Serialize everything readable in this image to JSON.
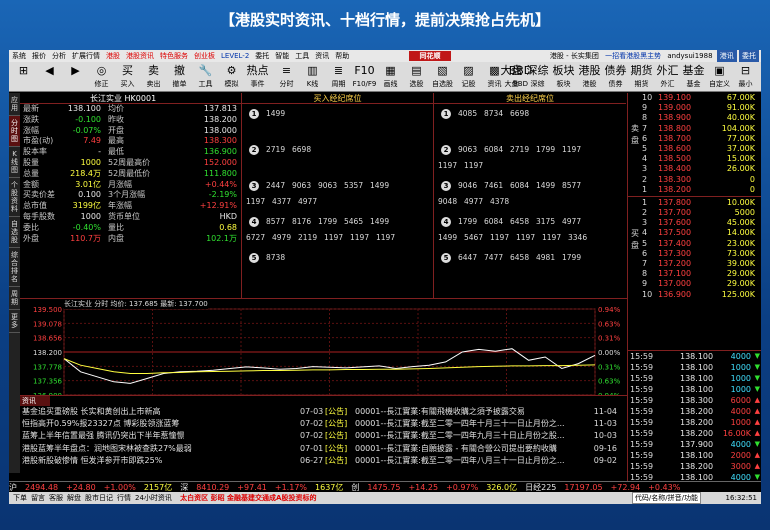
{
  "banner": "【港股实时资讯、十档行情，提前决策抢占先机】",
  "menu": {
    "items": [
      "系统",
      "报价",
      "分析",
      "扩展行情",
      "港股",
      "港股资讯",
      "特色服务",
      "创业板",
      "LEVEL-2",
      "委托",
      "智能",
      "工具",
      "资讯",
      "帮助"
    ],
    "brand": "同花顺",
    "crumb": "港股 - 长实集团",
    "promo": "一招看港股黑主势",
    "user": "andysui1988",
    "right_box1": "港讯",
    "right_box2": "委托"
  },
  "toolbar": {
    "left": [
      {
        "icon": "⊞",
        "label": ""
      },
      {
        "icon": "◀",
        "label": ""
      },
      {
        "icon": "▶",
        "label": ""
      },
      {
        "icon": "◎",
        "label": "修正"
      },
      {
        "icon": "买",
        "label": "买入"
      },
      {
        "icon": "卖",
        "label": "卖出"
      },
      {
        "icon": "撤",
        "label": "撤单"
      },
      {
        "icon": "🔧",
        "label": "工具"
      },
      {
        "icon": "⚙",
        "label": "模拟"
      },
      {
        "icon": "热点",
        "label": "事件"
      }
    ],
    "mid": [
      {
        "icon": "≡",
        "label": "分时"
      },
      {
        "icon": "▥",
        "label": "K线"
      },
      {
        "icon": "≣",
        "label": "周期"
      },
      {
        "icon": "F10",
        "label": "F10/F9"
      },
      {
        "icon": "▦",
        "label": "画线"
      },
      {
        "icon": "▤",
        "label": "选股"
      },
      {
        "icon": "▧",
        "label": "自选股"
      },
      {
        "icon": "▨",
        "label": "记股"
      },
      {
        "icon": "▩",
        "label": "资讯"
      },
      {
        "icon": "BBD",
        "label": "BBD"
      }
    ],
    "right": [
      {
        "icon": "大盘",
        "label": "大盘"
      },
      {
        "icon": "深综",
        "label": "深综"
      },
      {
        "icon": "板块",
        "label": "板块"
      },
      {
        "icon": "港股",
        "label": "港股"
      },
      {
        "icon": "债券",
        "label": "债券"
      },
      {
        "icon": "期货",
        "label": "期货"
      },
      {
        "icon": "外汇",
        "label": "外汇"
      },
      {
        "icon": "基金",
        "label": "基金"
      },
      {
        "icon": "▣",
        "label": "自定义"
      },
      {
        "icon": "⊟",
        "label": "最小"
      }
    ]
  },
  "left_tabs": [
    {
      "label": "应用",
      "active": false
    },
    {
      "label": "分时图",
      "active": true
    },
    {
      "label": "K线图",
      "active": false
    },
    {
      "label": "个股资料",
      "active": false
    },
    {
      "label": "自选股",
      "active": false
    },
    {
      "label": "综合排名",
      "active": false
    },
    {
      "label": "周期",
      "active": false
    },
    {
      "label": "更多",
      "active": false
    }
  ],
  "quote": {
    "title": "长江实业 HK0001",
    "rows": [
      {
        "l1": "最新",
        "v1": "138.100",
        "c1": "white",
        "l2": "均价",
        "v2": "137.813",
        "c2": "white"
      },
      {
        "l1": "涨跌",
        "v1": "-0.100",
        "c1": "green",
        "l2": "昨收",
        "v2": "138.200",
        "c2": "white"
      },
      {
        "l1": "涨幅",
        "v1": "-0.07%",
        "c1": "green",
        "l2": "开盘",
        "v2": "138.000",
        "c2": "white"
      },
      {
        "l1": "市盈(动)",
        "v1": "7.49",
        "c1": "red",
        "l2": "最高",
        "v2": "138.300",
        "c2": "red"
      },
      {
        "l1": "股本率",
        "v1": "-",
        "c1": "white",
        "l2": "最低",
        "v2": "136.900",
        "c2": "green"
      },
      {
        "l1": "股量",
        "v1": "1000",
        "c1": "yellow",
        "l2": "52周最高价",
        "v2": "152.000",
        "c2": "red"
      },
      {
        "l1": "总量",
        "v1": "218.4万",
        "c1": "yellow",
        "l2": "52周最低价",
        "v2": "111.800",
        "c2": "green"
      },
      {
        "l1": "金额",
        "v1": "3.01亿",
        "c1": "yellow",
        "l2": "月涨幅",
        "v2": "+0.44%",
        "c2": "red"
      },
      {
        "l1": "买卖价差",
        "v1": "0.100",
        "c1": "white",
        "l2": "3个月涨幅",
        "v2": "-2.19%",
        "c2": "green"
      },
      {
        "l1": "总市值",
        "v1": "3199亿",
        "c1": "yellow",
        "l2": "年涨幅",
        "v2": "+12.91%",
        "c2": "red"
      },
      {
        "l1": "每手股数",
        "v1": "1000",
        "c1": "white",
        "l2": "货币单位",
        "v2": "HKD",
        "c2": "white"
      },
      {
        "l1": "委比",
        "v1": "-0.40%",
        "c1": "green",
        "l2": "量比",
        "v2": "0.68",
        "c2": "yellow"
      },
      {
        "l1": "外盘",
        "v1": "110.7万",
        "c1": "red",
        "l2": "内盘",
        "v2": "102.1万",
        "c2": "green"
      }
    ]
  },
  "brokers": {
    "buy_title": "买入经纪席位",
    "sell_title": "卖出经纪席位",
    "buy": [
      {
        "n": "1",
        "lines": [
          [
            "1499"
          ]
        ]
      },
      {
        "n": "2",
        "lines": [
          [
            "2719",
            "6698"
          ]
        ]
      },
      {
        "n": "3",
        "lines": [
          [
            "2447",
            "9063",
            "9063",
            "5357",
            "1499"
          ],
          [
            "1197",
            "4377",
            "4977"
          ]
        ]
      },
      {
        "n": "4",
        "lines": [
          [
            "8577",
            "8176",
            "1799",
            "5465",
            "1499"
          ],
          [
            "6727",
            "4979",
            "2119",
            "1197",
            "1197",
            "1197"
          ]
        ]
      },
      {
        "n": "5",
        "lines": [
          [
            "8738"
          ]
        ]
      }
    ],
    "sell": [
      {
        "n": "1",
        "lines": [
          [
            "4085",
            "8734",
            "6698"
          ]
        ]
      },
      {
        "n": "2",
        "lines": [
          [
            "9063",
            "6084",
            "2719",
            "1799",
            "1197"
          ],
          [
            "1197",
            "1197"
          ]
        ]
      },
      {
        "n": "3",
        "lines": [
          [
            "9046",
            "7461",
            "6084",
            "1499",
            "8577"
          ],
          [
            "9048",
            "4977",
            "4378"
          ]
        ]
      },
      {
        "n": "4",
        "lines": [
          [
            "1799",
            "6084",
            "6458",
            "3175",
            "4977"
          ],
          [
            "1499",
            "5467",
            "1197",
            "1197",
            "1197",
            "3346"
          ]
        ]
      },
      {
        "n": "5",
        "lines": [
          [
            "6447",
            "7477",
            "6458",
            "4981",
            "1799"
          ]
        ]
      }
    ]
  },
  "orderbook": {
    "sell_label": "卖盘",
    "buy_label": "买盘",
    "sell": [
      {
        "n": "10",
        "p": "139.100",
        "q": "67.00K"
      },
      {
        "n": "9",
        "p": "139.000",
        "q": "91.00K"
      },
      {
        "n": "8",
        "p": "138.900",
        "q": "40.00K"
      },
      {
        "n": "7",
        "p": "138.800",
        "q": "104.00K"
      },
      {
        "n": "6",
        "p": "138.700",
        "q": "77.00K"
      },
      {
        "n": "5",
        "p": "138.600",
        "q": "37.00K"
      },
      {
        "n": "4",
        "p": "138.500",
        "q": "15.00K"
      },
      {
        "n": "3",
        "p": "138.400",
        "q": "26.00K"
      },
      {
        "n": "2",
        "p": "138.300",
        "q": "0"
      },
      {
        "n": "1",
        "p": "138.200",
        "q": "0"
      }
    ],
    "buy": [
      {
        "n": "1",
        "p": "137.800",
        "q": "10.00K"
      },
      {
        "n": "2",
        "p": "137.700",
        "q": "5000"
      },
      {
        "n": "3",
        "p": "137.600",
        "q": "45.00K"
      },
      {
        "n": "4",
        "p": "137.500",
        "q": "14.00K"
      },
      {
        "n": "5",
        "p": "137.400",
        "q": "23.00K"
      },
      {
        "n": "6",
        "p": "137.300",
        "q": "73.00K"
      },
      {
        "n": "7",
        "p": "137.200",
        "q": "39.00K"
      },
      {
        "n": "8",
        "p": "137.100",
        "q": "29.00K"
      },
      {
        "n": "9",
        "p": "137.000",
        "q": "29.00K"
      },
      {
        "n": "10",
        "p": "136.900",
        "q": "125.00K"
      }
    ]
  },
  "ticks": [
    {
      "t": "15:59",
      "p": "138.100",
      "q": "4000",
      "a": "▼",
      "c": "green"
    },
    {
      "t": "15:59",
      "p": "138.100",
      "q": "1000",
      "a": "▼",
      "c": "green"
    },
    {
      "t": "15:59",
      "p": "138.100",
      "q": "1000",
      "a": "▼",
      "c": "green"
    },
    {
      "t": "15:59",
      "p": "138.100",
      "q": "1000",
      "a": "▼",
      "c": "green"
    },
    {
      "t": "15:59",
      "p": "138.300",
      "q": "6000",
      "a": "▲",
      "c": "red"
    },
    {
      "t": "15:59",
      "p": "138.200",
      "q": "4000",
      "a": "▲",
      "c": "red"
    },
    {
      "t": "15:59",
      "p": "138.200",
      "q": "1000",
      "a": "▲",
      "c": "red"
    },
    {
      "t": "15:59",
      "p": "138.200",
      "q": "16.00K",
      "a": "▲",
      "c": "red"
    },
    {
      "t": "15:59",
      "p": "137.900",
      "q": "4000",
      "a": "▼",
      "c": "green"
    },
    {
      "t": "15:59",
      "p": "138.100",
      "q": "2000",
      "a": "▲",
      "c": "red"
    },
    {
      "t": "15:59",
      "p": "138.200",
      "q": "3000",
      "a": "▲",
      "c": "red"
    },
    {
      "t": "15:59",
      "p": "138.100",
      "q": "4000",
      "a": "▼",
      "c": "green"
    },
    {
      "t": "15:59",
      "p": "138.100",
      "q": "1000",
      "a": "▼",
      "c": "green"
    }
  ],
  "chart_title": "长江实业 分时 均价: 137.685 最新: 137.700",
  "chart_data": {
    "type": "line",
    "x_ticks": [
      "09:30",
      "10:30",
      "11:30",
      "13:00",
      "14:00",
      "15:00",
      "16:00"
    ],
    "y_left_ticks": [
      "139.500",
      "139.078",
      "138.656",
      "138.200",
      "137.778",
      "137.356",
      "136.900"
    ],
    "y_right_ticks": [
      "0.94%",
      "0.63%",
      "0.31%",
      "0.00%",
      "0.31%",
      "0.63%",
      "0.94%"
    ],
    "volume_ticks": [
      "7900",
      "3950"
    ],
    "prev_close": 138.2,
    "ylim": [
      136.9,
      139.5
    ],
    "series": [
      {
        "name": "价格",
        "color": "#ffffff",
        "values": [
          138.0,
          137.6,
          137.45,
          137.3,
          137.25,
          137.4,
          137.55,
          137.6,
          137.62,
          137.65,
          137.7,
          137.75,
          137.72,
          137.68,
          137.7,
          137.76,
          137.74,
          137.72,
          137.75,
          137.78,
          137.7,
          137.76,
          137.8,
          137.9,
          138.2,
          138.28,
          138.22,
          138.3,
          137.95,
          138.05,
          137.7,
          137.85,
          138.1
        ]
      },
      {
        "name": "均价",
        "color": "#ffff40",
        "values": [
          138.0,
          137.8,
          137.7,
          137.6,
          137.55,
          137.55,
          137.57,
          137.58,
          137.6,
          137.61,
          137.62,
          137.63,
          137.64,
          137.64,
          137.65,
          137.66,
          137.66,
          137.67,
          137.67,
          137.68,
          137.68,
          137.69,
          137.7,
          137.72,
          137.74,
          137.76,
          137.77,
          137.78,
          137.78,
          137.79,
          137.79,
          137.8,
          137.81
        ]
      }
    ],
    "volume": [
      0.9,
      0.5,
      0.3,
      0.35,
      0.25,
      0.3,
      0.2,
      0.25,
      0.2,
      0.22,
      0.18,
      0.2,
      0.15,
      0.18,
      0.2,
      0.15,
      0.2,
      0.18,
      0.22,
      0.2,
      0.25,
      0.3,
      0.28,
      0.35,
      0.4,
      0.45,
      0.5,
      0.4,
      0.55,
      0.45,
      0.5,
      0.6,
      0.95
    ]
  },
  "news": {
    "tag": "资讯",
    "rows": [
      {
        "lt": "基金追买重磅股 长实和黄创出上市新高",
        "d": "07-03",
        "tag": "[公告]",
        "rt": "00001--長江實業:有關飛機收購之須予披露交易",
        "d2": "11-04"
      },
      {
        "lt": "恒指高开0.59%报23327点 博彩股领涨蓝筹",
        "d": "07-02",
        "tag": "[公告]",
        "rt": "00001--長江實業:截至二零一四年十月三十一日止月份之...",
        "d2": "11-03"
      },
      {
        "lt": "蓝筹上半年信置最强 腾讯仍突出下半年惹憧憬",
        "d": "07-02",
        "tag": "[公告]",
        "rt": "00001--長江實業:截至二零一四年九月三十日止月份之股...",
        "d2": "10-03"
      },
      {
        "lt": "港股蓝筹半年盘点：润地图宋林被查跌27%最弱",
        "d": "07-01",
        "tag": "[公告]",
        "rt": "00001--長江實業:自願披露 - 有關合營公司提出要約收購",
        "d2": "09-16"
      },
      {
        "lt": "港股新股破惨情 恒发洋参开市即跌25%",
        "d": "06-27",
        "tag": "[公告]",
        "rt": "00001--長江實業:截至二零一四年八月三十一日止月份之...",
        "d2": "09-02"
      }
    ],
    "tabs": [
      "分时",
      "K线",
      "成交明细",
      "买入卖出",
      "关联品种",
      "财务",
      "资讯"
    ]
  },
  "status1": [
    {
      "t": "沪",
      "c": "white"
    },
    {
      "t": "2494.48",
      "c": "red"
    },
    {
      "t": "+24.80",
      "c": "red"
    },
    {
      "t": "+1.00%",
      "c": "red"
    },
    {
      "t": "2157亿",
      "c": "yellow"
    },
    {
      "t": "深",
      "c": "white"
    },
    {
      "t": "8410.29",
      "c": "red"
    },
    {
      "t": "+97.41",
      "c": "red"
    },
    {
      "t": "+1.17%",
      "c": "red"
    },
    {
      "t": "1637亿",
      "c": "yellow"
    },
    {
      "t": "创",
      "c": "white"
    },
    {
      "t": "1475.75",
      "c": "red"
    },
    {
      "t": "+14.25",
      "c": "red"
    },
    {
      "t": "+0.97%",
      "c": "red"
    },
    {
      "t": "326.0亿",
      "c": "yellow"
    },
    {
      "t": "日经225",
      "c": "white"
    },
    {
      "t": "17197.05",
      "c": "red"
    },
    {
      "t": "+72.94",
      "c": "red"
    },
    {
      "t": "+0.43%",
      "c": "red"
    }
  ],
  "status2": {
    "items": [
      "下单",
      "留言",
      "客服",
      "解盘",
      "股市日记",
      "行情",
      "24小时资讯"
    ],
    "highlight": "太白资区 彭昭 金融基建交通成A股投资标的",
    "code_box": "代码/名称/拼音/功能",
    "time": "16:32:51"
  }
}
